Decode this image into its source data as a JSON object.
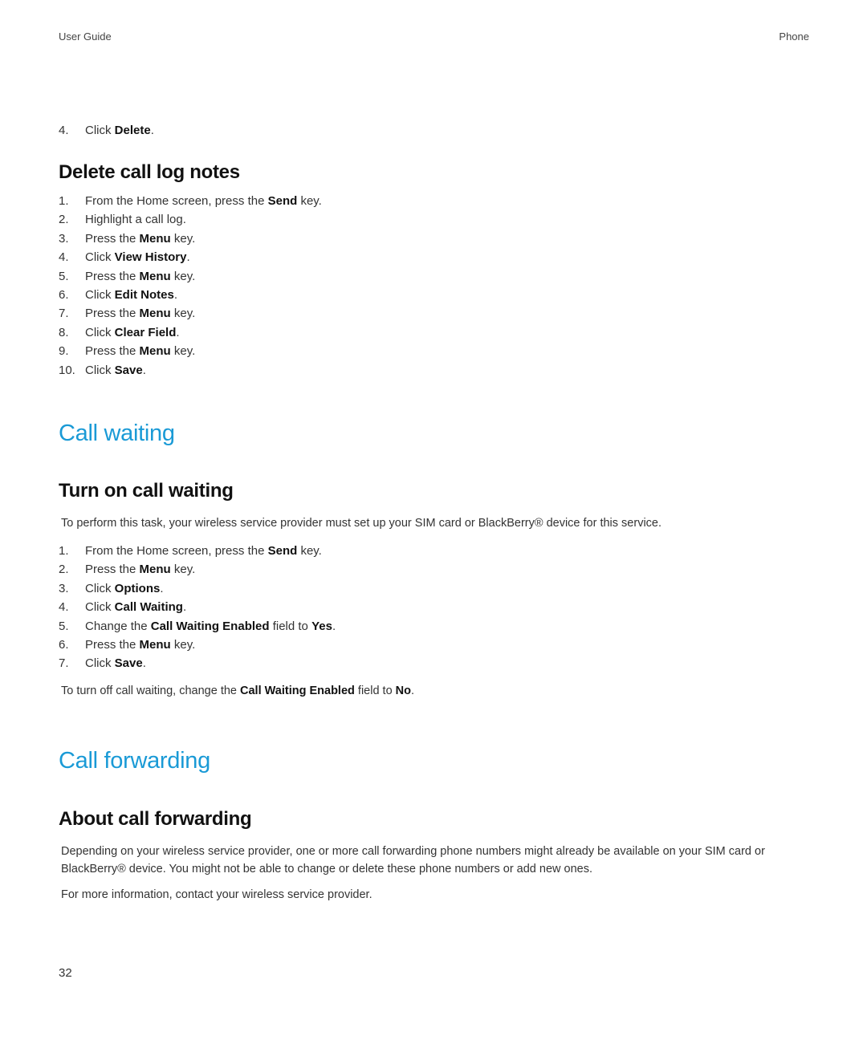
{
  "header": {
    "left": "User Guide",
    "right": "Phone"
  },
  "continued_step": {
    "num": "4.",
    "pre": "Click ",
    "bold": "Delete",
    "post": "."
  },
  "delete_call_log_notes": {
    "title": "Delete call log notes",
    "steps": [
      {
        "num": "1.",
        "pre": "From the Home screen, press the ",
        "bold": "Send",
        "post": " key."
      },
      {
        "num": "2.",
        "pre": "Highlight a call log.",
        "bold": "",
        "post": ""
      },
      {
        "num": "3.",
        "pre": "Press the ",
        "bold": "Menu",
        "post": " key."
      },
      {
        "num": "4.",
        "pre": "Click ",
        "bold": "View History",
        "post": "."
      },
      {
        "num": "5.",
        "pre": "Press the ",
        "bold": "Menu",
        "post": " key."
      },
      {
        "num": "6.",
        "pre": "Click ",
        "bold": "Edit Notes",
        "post": "."
      },
      {
        "num": "7.",
        "pre": "Press the ",
        "bold": "Menu",
        "post": " key."
      },
      {
        "num": "8.",
        "pre": "Click ",
        "bold": "Clear Field",
        "post": "."
      },
      {
        "num": "9.",
        "pre": "Press the ",
        "bold": "Menu",
        "post": " key."
      },
      {
        "num": "10.",
        "pre": "Click ",
        "bold": "Save",
        "post": "."
      }
    ]
  },
  "call_waiting": {
    "title": "Call waiting",
    "subtitle": "Turn on call waiting",
    "intro": "To perform this task, your wireless service provider must set up your SIM card or BlackBerry® device for this service.",
    "steps": [
      {
        "num": "1.",
        "pre": "From the Home screen, press the ",
        "bold": "Send",
        "post": " key."
      },
      {
        "num": "2.",
        "pre": "Press the ",
        "bold": "Menu",
        "post": " key."
      },
      {
        "num": "3.",
        "pre": "Click ",
        "bold": "Options",
        "post": "."
      },
      {
        "num": "4.",
        "pre": "Click ",
        "bold": "Call Waiting",
        "post": "."
      },
      {
        "num": "5.",
        "pre": "Change the ",
        "bold": "Call Waiting Enabled",
        "post": " field to ",
        "bold2": "Yes",
        "post2": "."
      },
      {
        "num": "6.",
        "pre": "Press the ",
        "bold": "Menu",
        "post": " key."
      },
      {
        "num": "7.",
        "pre": "Click ",
        "bold": "Save",
        "post": "."
      }
    ],
    "outro": {
      "pre": "To turn off call waiting, change the ",
      "bold": "Call Waiting Enabled",
      "mid": " field to ",
      "bold2": "No",
      "post": "."
    }
  },
  "call_forwarding": {
    "title": "Call forwarding",
    "subtitle": "About call forwarding",
    "para1": "Depending on your wireless service provider, one or more call forwarding phone numbers might already be available on your SIM card or BlackBerry® device. You might not be able to change or delete these phone numbers or add new ones.",
    "para2": "For more information, contact your wireless service provider."
  },
  "page_number": "32"
}
